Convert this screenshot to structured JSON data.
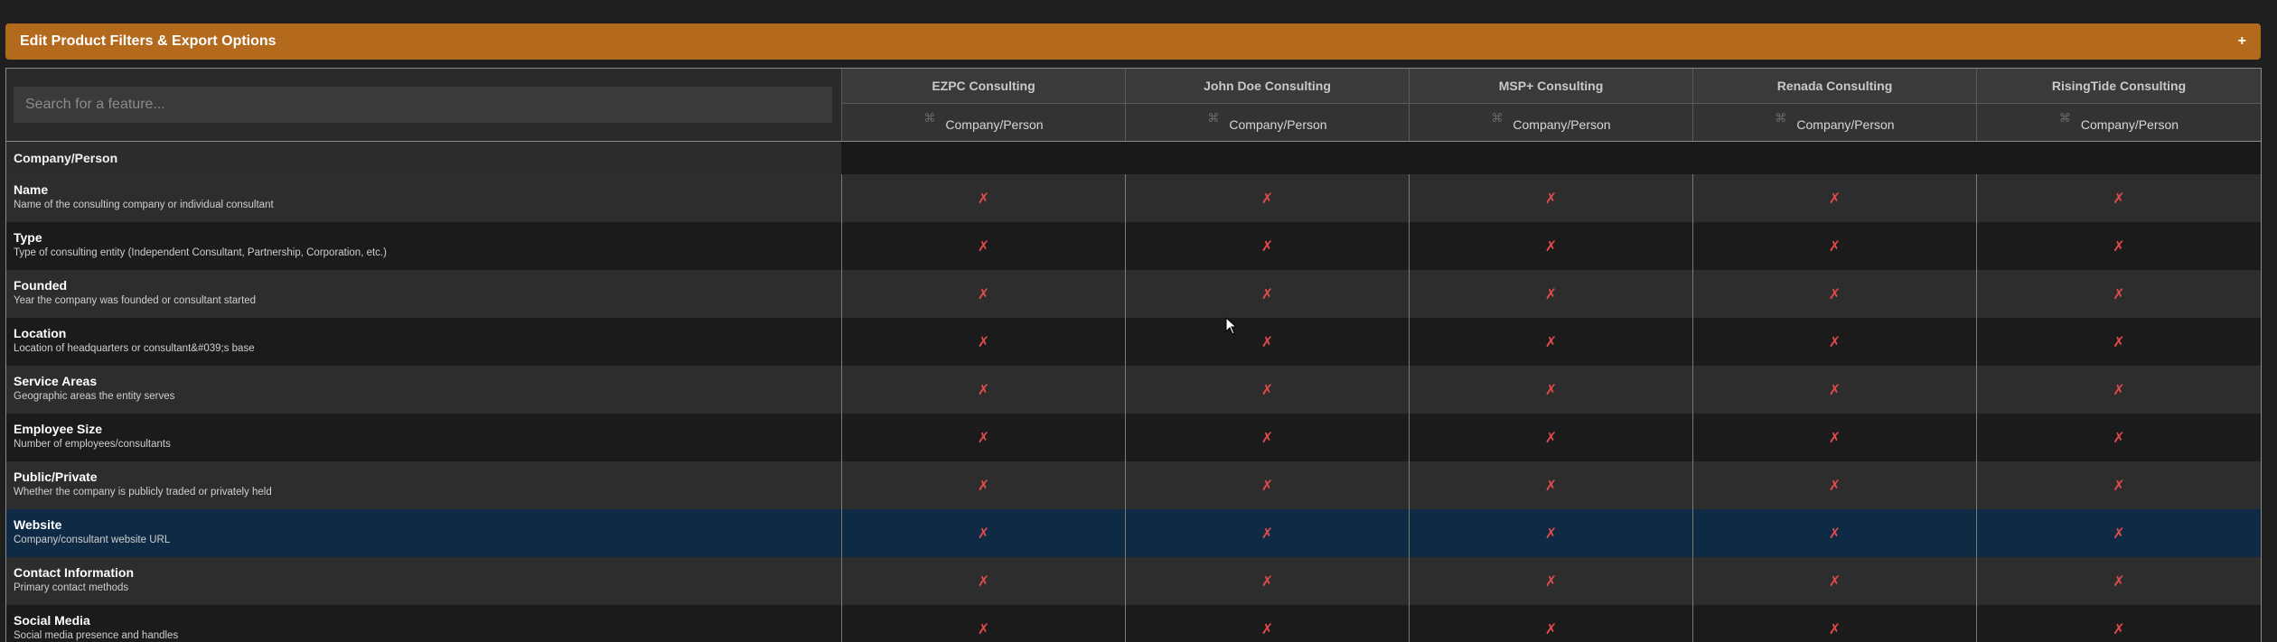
{
  "filter_bar": {
    "title": "Edit Product Filters & Export Options",
    "toggle": "+"
  },
  "search": {
    "placeholder": "Search for a feature..."
  },
  "vendors": [
    {
      "name": "EZPC Consulting",
      "sub": "Company/Person"
    },
    {
      "name": "John Doe Consulting",
      "sub": "Company/Person"
    },
    {
      "name": "MSP+ Consulting",
      "sub": "Company/Person"
    },
    {
      "name": "Renada Consulting",
      "sub": "Company/Person"
    },
    {
      "name": "RisingTide Consulting",
      "sub": "Company/Person"
    }
  ],
  "section": {
    "label": "Company/Person"
  },
  "rows": [
    {
      "name": "Name",
      "desc": "Name of the consulting company or individual consultant",
      "mark": "✗"
    },
    {
      "name": "Type",
      "desc": "Type of consulting entity (Independent Consultant, Partnership, Corporation, etc.)",
      "mark": "✗"
    },
    {
      "name": "Founded",
      "desc": "Year the company was founded or consultant started",
      "mark": "✗"
    },
    {
      "name": "Location",
      "desc": "Location of headquarters or consultant&#039;s base",
      "mark": "✗"
    },
    {
      "name": "Service Areas",
      "desc": "Geographic areas the entity serves",
      "mark": "✗"
    },
    {
      "name": "Employee Size",
      "desc": "Number of employees/consultants",
      "mark": "✗"
    },
    {
      "name": "Public/Private",
      "desc": "Whether the company is publicly traded or privately held",
      "mark": "✗"
    },
    {
      "name": "Website",
      "desc": "Company/consultant website URL",
      "mark": "✗"
    },
    {
      "name": "Contact Information",
      "desc": "Primary contact methods",
      "mark": "✗"
    },
    {
      "name": "Social Media",
      "desc": "Social media presence and handles",
      "mark": "✗"
    }
  ],
  "colors": {
    "accent": "#b36a1d",
    "cross": "#e04a4a",
    "highlight": "#0e2a45"
  }
}
